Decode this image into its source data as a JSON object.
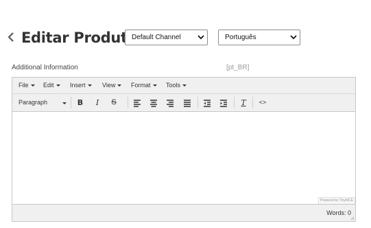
{
  "header": {
    "title": "Editar Produto",
    "channel_select": "Default Channel",
    "language_select": "Português"
  },
  "field": {
    "label": "Additional Information",
    "locale": "[pt_BR]"
  },
  "editor": {
    "menus": [
      "File",
      "Edit",
      "Insert",
      "View",
      "Format",
      "Tools"
    ],
    "block_format": "Paragraph",
    "bold_glyph": "B",
    "italic_glyph": "I",
    "strike_glyph": "S",
    "clear_glyph": "T",
    "code_glyph": "<>",
    "powered_by": "Powered by TinyMCE",
    "word_count": "Words: 0"
  },
  "colors": {
    "toolbar_bg": "#f0f0f0",
    "border": "#c7c7c7",
    "title": "#333333"
  }
}
